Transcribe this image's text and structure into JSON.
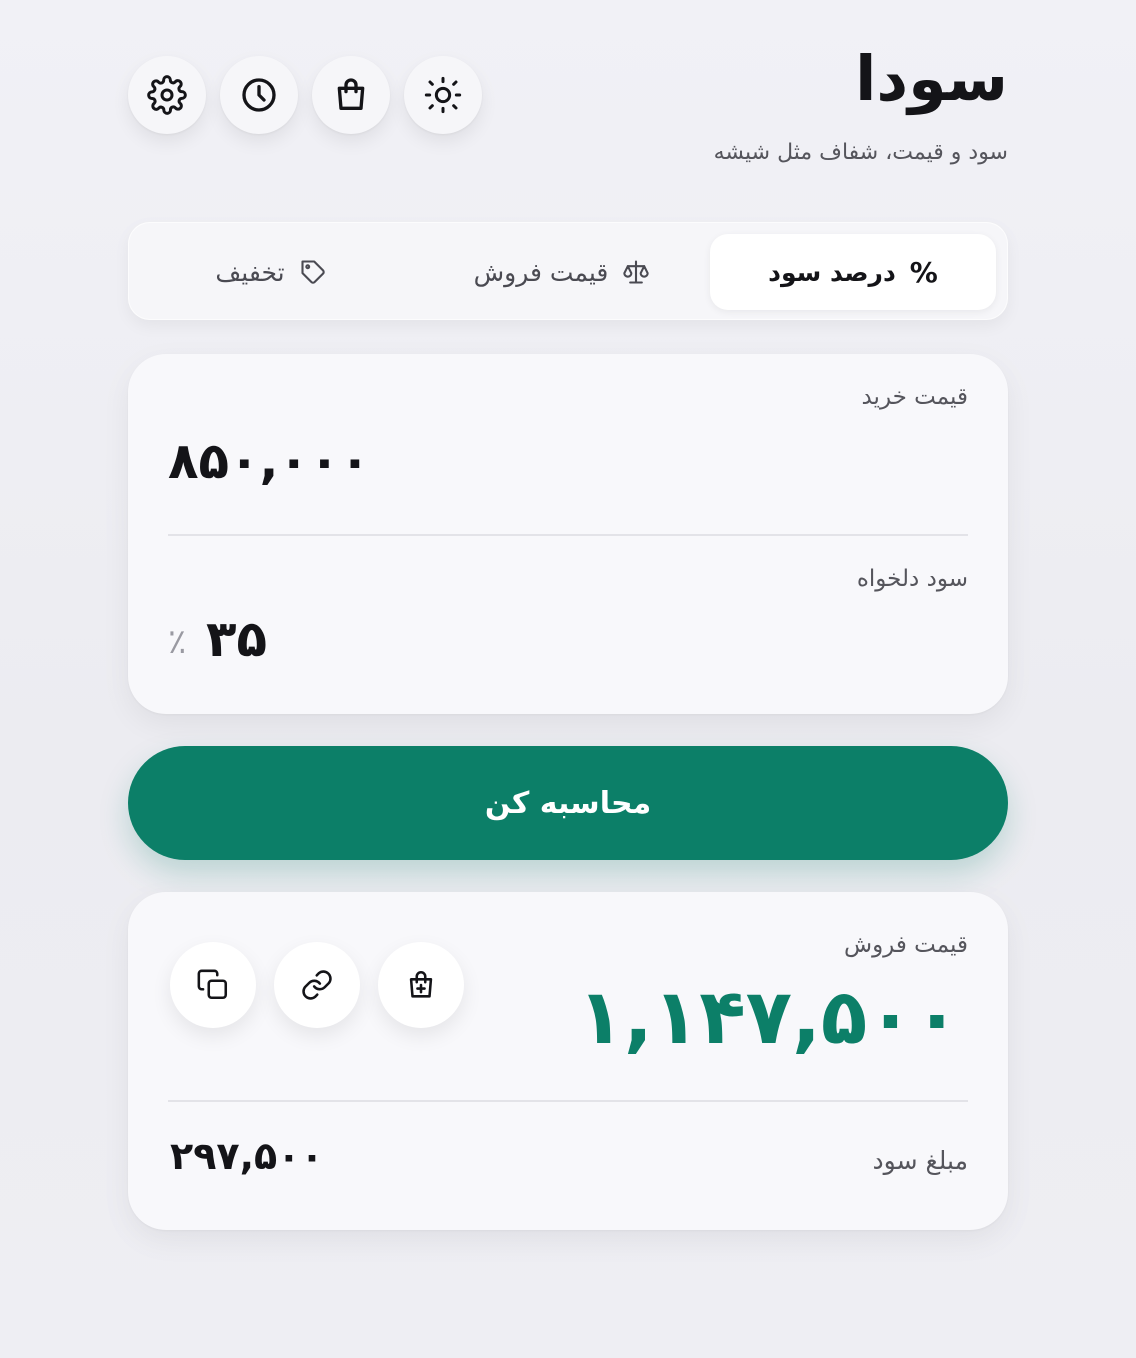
{
  "header": {
    "title": "سودا",
    "subtitle": "سود و قیمت، شفاف مثل شیشه",
    "icons": [
      "settings-icon",
      "clock-icon",
      "shopping-bag-icon",
      "sun-icon"
    ]
  },
  "tabs": [
    {
      "label": "درصد سود",
      "icon": "percent-icon",
      "active": true
    },
    {
      "label": "قیمت فروش",
      "icon": "scale-icon",
      "active": false
    },
    {
      "label": "تخفیف",
      "icon": "tag-icon",
      "active": false
    }
  ],
  "inputs": {
    "purchase_price": {
      "label": "قیمت خرید",
      "value": "۸۵۰,۰۰۰"
    },
    "desired_profit": {
      "label": "سود دلخواه",
      "value": "۳۵",
      "unit": "٪"
    }
  },
  "calculate_button": {
    "label": "محاسبه کن"
  },
  "result": {
    "sale_price_label": "قیمت فروش",
    "sale_price_value": "۱,۱۴۷,۵۰۰",
    "profit_amount_label": "مبلغ سود",
    "profit_amount_value": "۲۹۷,۵۰۰",
    "actions": [
      "copy-icon",
      "link-icon",
      "add-to-bag-icon"
    ]
  },
  "colors": {
    "accent": "#0c7f68",
    "background": "#f1f1f6",
    "card": "#f8f8fb",
    "text": "#141418"
  }
}
